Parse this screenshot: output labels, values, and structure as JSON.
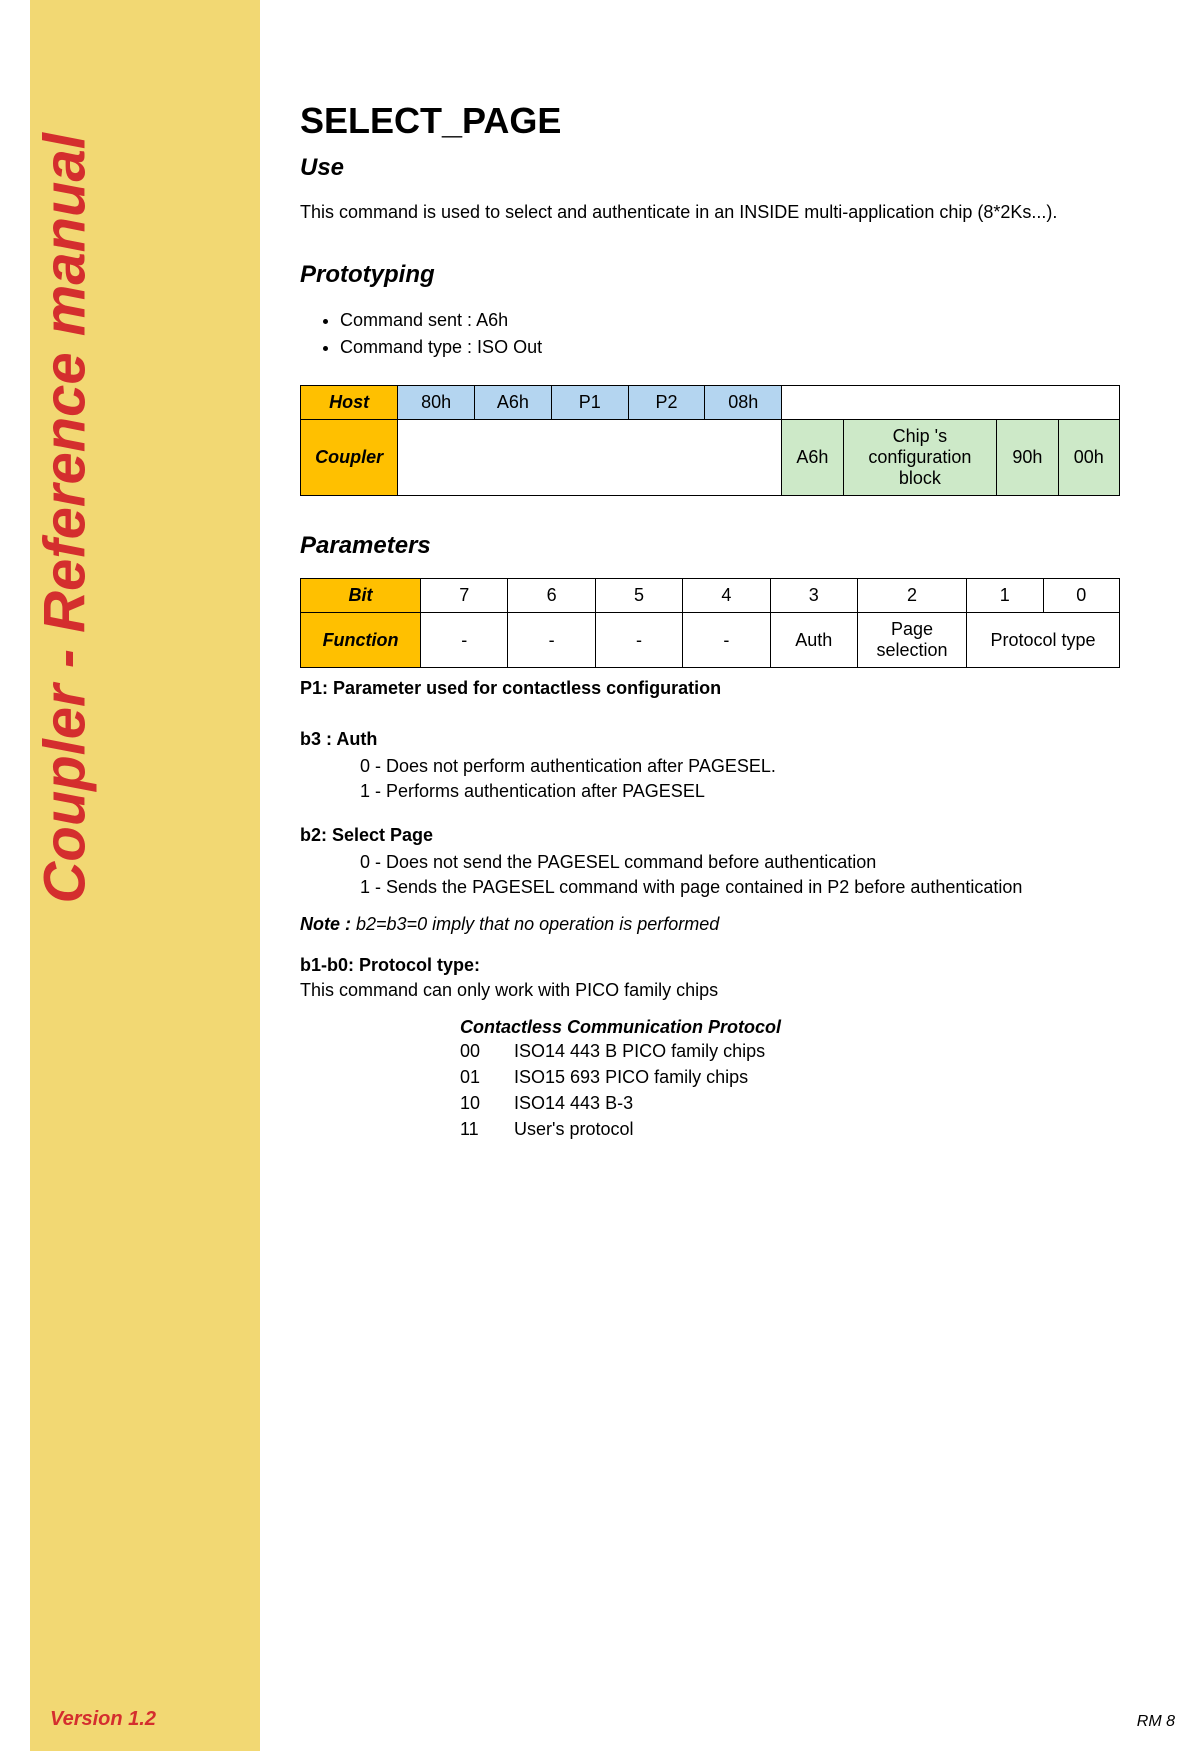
{
  "sidebar": {
    "title": "Coupler - Reference manual",
    "version": "Version 1.2"
  },
  "page": {
    "title": "SELECT_PAGE",
    "footer": "RM 8"
  },
  "use": {
    "heading": "Use",
    "text": "This command is used to select and authenticate in an INSIDE multi-application chip (8*2Ks...)."
  },
  "prototyping": {
    "heading": "Prototyping",
    "bullets": [
      "Command sent : A6h",
      "Command type : ISO Out"
    ],
    "table": {
      "host_label": "Host",
      "host_cells": [
        "80h",
        "A6h",
        "P1",
        "P2",
        "08h"
      ],
      "coupler_label": "Coupler",
      "coupler_cells": [
        "A6h",
        "Chip 's configuration block",
        "90h",
        "00h"
      ]
    }
  },
  "parameters": {
    "heading": "Parameters",
    "bit_label": "Bit",
    "bit_cells": [
      "7",
      "6",
      "5",
      "4",
      "3",
      "2",
      "1",
      "0"
    ],
    "func_label": "Function",
    "func_cells": [
      "-",
      "-",
      "-",
      "-",
      "Auth",
      "Page selection",
      "Protocol type"
    ],
    "p1_caption": "P1: Parameter used for contactless configuration",
    "b3": {
      "title": "b3 : Auth",
      "line0": "0 - Does not perform authentication after PAGESEL.",
      "line1": "1 - Performs authentication after PAGESEL"
    },
    "b2": {
      "title": "b2: Select Page",
      "line0": "0 - Does not send the PAGESEL command before authentication",
      "line1": "1 - Sends the PAGESEL command with page contained in P2 before authentication"
    },
    "note": {
      "label": "Note : ",
      "text": "b2=b3=0 imply that no operation is performed"
    },
    "b1b0": {
      "title": "b1-b0: Protocol type:",
      "text": "This command can only work with PICO family chips"
    },
    "ccp": {
      "heading": "Contactless Communication Protocol",
      "rows": [
        {
          "code": "00",
          "desc": "ISO14 443 B PICO family chips"
        },
        {
          "code": "01",
          "desc": "ISO15 693 PICO family chips"
        },
        {
          "code": "10",
          "desc": "ISO14 443 B-3"
        },
        {
          "code": "11",
          "desc": "User's protocol"
        }
      ]
    }
  }
}
